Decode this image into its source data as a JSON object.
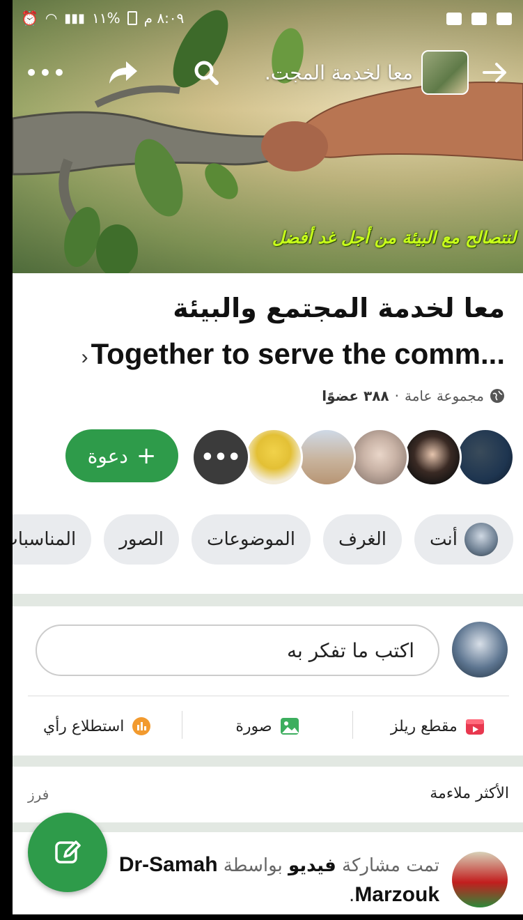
{
  "status_bar": {
    "time": "٨:٠٩ م",
    "battery": "%١١"
  },
  "header": {
    "group_short_title": "معا لخدمة المجت.",
    "back_icon": "arrow-right-icon",
    "search_icon": "search-icon",
    "share_icon": "share-icon",
    "more_icon": "more-dots-icon"
  },
  "cover": {
    "caption": "لنتصالح مع البيئة من أجل غد أفضل"
  },
  "group": {
    "name_ar": "معا لخدمة المجتمع والبيئة",
    "name_en": "Together to serve the comm...",
    "privacy": "مجموعة عامة",
    "separator": "·",
    "members": "٣٨٨ عضوًا"
  },
  "members_row": {
    "more_label": "•••",
    "invite_label": "دعوة"
  },
  "tabs": [
    {
      "label": "أنت"
    },
    {
      "label": "الغرف"
    },
    {
      "label": "الموضوعات"
    },
    {
      "label": "الصور"
    },
    {
      "label": "المناسبات"
    }
  ],
  "composer": {
    "placeholder": "اكتب ما تفكر به"
  },
  "actions": [
    {
      "label": "مقطع ريلز",
      "icon": "reels-icon"
    },
    {
      "label": "صورة",
      "icon": "photo-icon"
    },
    {
      "label": "استطلاع رأي",
      "icon": "poll-icon"
    }
  ],
  "feed": {
    "sort_label": "الأكثر ملاءمة",
    "sort_button": "فرز"
  },
  "post": {
    "shared_prefix": "تمت مشاركة",
    "type": "فيديو",
    "by": "بواسطة",
    "author": "Dr-Samah Marzouk",
    "suffix": "."
  },
  "colors": {
    "accent": "#2e9b4a",
    "tab_bg": "#e9ebee",
    "divider": "#e2e8e2"
  }
}
